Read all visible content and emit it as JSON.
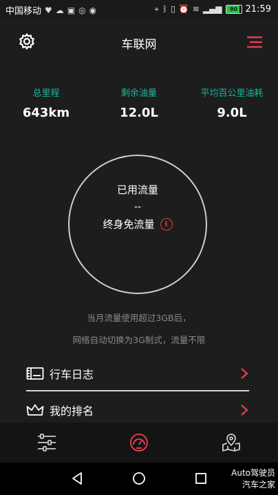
{
  "status_bar": {
    "carrier": "中国移动",
    "battery": "90",
    "time": "21:59"
  },
  "header": {
    "title": "车联网"
  },
  "stats": [
    {
      "label": "总里程",
      "value": "643km"
    },
    {
      "label": "剩余油量",
      "value": "12.0L"
    },
    {
      "label": "平均百公里油耗",
      "value": "9.0L"
    }
  ],
  "data_circle": {
    "used_label": "已用流量",
    "used_value": "--",
    "plan_label": "终身免流量",
    "info_glyph": "i"
  },
  "notes": [
    "当月流量使用超过3GB后，",
    "网络自动切换为3G制式，流量不限"
  ],
  "list": [
    {
      "label": "行车日志",
      "icon": "logbook-icon"
    },
    {
      "label": "我的排名",
      "icon": "crown-icon"
    }
  ],
  "tabbar": {
    "items": [
      "sliders-icon",
      "speedometer-icon",
      "map-pin-icon"
    ],
    "active_color": "#e23d50"
  },
  "watermark": {
    "line1": "Auto驾驶员",
    "line2": "汽车之家"
  },
  "colors": {
    "accent_red": "#e23d50",
    "accent_teal": "#19b79a",
    "background": "#1d1d1d"
  }
}
